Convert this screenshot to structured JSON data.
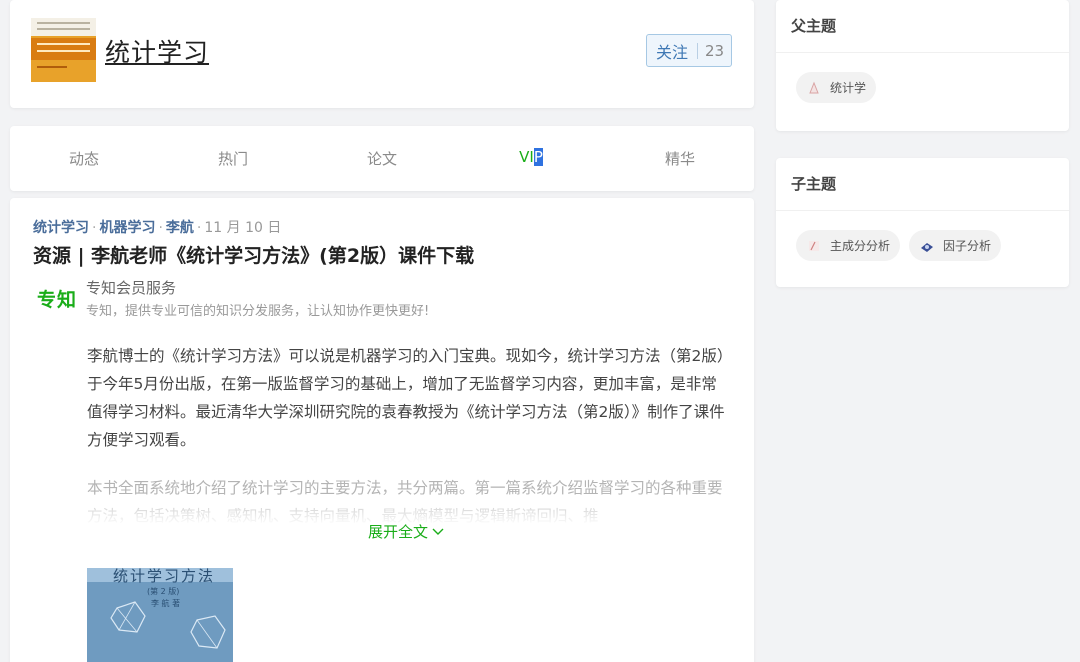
{
  "topic": {
    "title": "统计学习",
    "follow_label": "关注",
    "follow_count": "23",
    "cover_icon": "book-cover-elements-of-statistical-learning"
  },
  "tabs": [
    {
      "label": "动态",
      "active": false
    },
    {
      "label": "热门",
      "active": false
    },
    {
      "label": "论文",
      "active": false
    },
    {
      "label": "VIP",
      "active": true
    },
    {
      "label": "精华",
      "active": false
    }
  ],
  "post": {
    "tags": [
      "统计学习",
      "机器学习",
      "李航"
    ],
    "date": "11 月 10 日",
    "title": "资源 | 李航老师《统计学习方法》(第2版）课件下载",
    "source": {
      "logo_text": "专知",
      "name": "专知会员服务",
      "description": "专知，提供专业可信的知识分发服务，让认知协作更快更好!"
    },
    "paragraph1": "李航博士的《统计学习方法》可以说是机器学习的入门宝典。现如今，统计学习方法（第2版）于今年5月份出版，在第一版监督学习的基础上，增加了无监督学习内容，更加丰富，是非常值得学习材料。最近清华大学深圳研究院的袁春教授为《统计学习方法（第2版）》制作了课件方便学习观看。",
    "paragraph2": "本书全面系统地介绍了统计学习的主要方法，共分两篇。第一篇系统介绍监督学习的各种重要方法，包括决策树、感知机、支持向量机、最大熵模型与逻辑斯谛回归、推",
    "expand_label": "展开全文",
    "book_image": {
      "title": "统计学习方法",
      "edition": "(第 2 版)",
      "author": "李 航 著"
    }
  },
  "sidebar": {
    "parent": {
      "heading": "父主题",
      "items": [
        {
          "label": "统计学",
          "icon": "statistics-icon"
        }
      ]
    },
    "children": {
      "heading": "子主题",
      "items": [
        {
          "label": "主成分分析",
          "icon": "pca-icon"
        },
        {
          "label": "因子分析",
          "icon": "factor-analysis-icon"
        }
      ]
    }
  },
  "colors": {
    "accent_green": "#1aad19",
    "link_blue": "#4a6d9a",
    "follow_blue": "#3f78b4"
  }
}
